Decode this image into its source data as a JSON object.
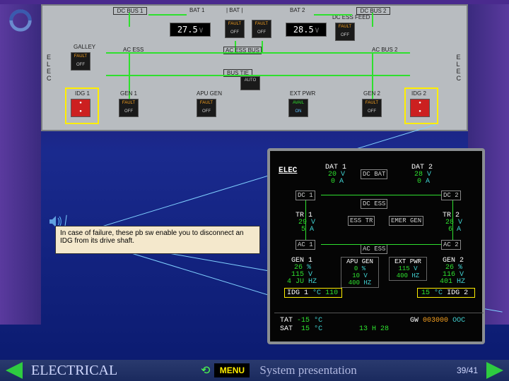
{
  "logo_name": "swirl-logo",
  "overhead": {
    "elec_label": "E L E C",
    "labels": {
      "dc_bus1": "DC BUS 1",
      "dc_bus2": "DC BUS 2",
      "bat1": "BAT 1",
      "bat2": "BAT 2",
      "bat_tog": "| BAT |",
      "dc_ess_feed": "DC ESS FEED",
      "galley": "GALLEY",
      "ac_ess": "AC ESS",
      "ac_ess_bus": "AC ESS BUS",
      "ac_bus2": "AC BUS 2",
      "bus_tie": "BUS TIE",
      "idg1": "IDG 1",
      "idg2": "IDG 2",
      "gen1": "GEN 1",
      "gen2": "GEN 2",
      "apu_gen": "APU GEN",
      "ext_pwr": "EXT PWR"
    },
    "batt1": {
      "value": "27.5",
      "unit": "V"
    },
    "batt2": {
      "value": "28.5",
      "unit": "V"
    },
    "pbsw": {
      "fault": "FAULT",
      "off": "OFF",
      "auto": "AUTO",
      "avail": "AVAIL",
      "on": "ON"
    }
  },
  "tooltip": "In case of failure, these pb sw enable you to disconnect an IDG from its drive shaft.",
  "ecam": {
    "title": "ELEC",
    "dc_bat": "DC BAT",
    "dat1": {
      "label": "DAT 1",
      "v": "20",
      "a": "0"
    },
    "dat2": {
      "label": "DAT 2",
      "v": "28",
      "a": "0"
    },
    "dc1": "DC 1",
    "dc2": "DC 2",
    "dc_ess": "DC ESS",
    "tr1": {
      "label": "TR 1",
      "v": "29",
      "a": "5"
    },
    "tr2": {
      "label": "TR 2",
      "v": "28",
      "a": "6"
    },
    "ess_tr": "ESS TR",
    "emer_gen": "EMER GEN",
    "ac1": "AC 1",
    "ac2": "AC 2",
    "ac_ess": "AC ESS",
    "gen1": {
      "label": "GEN 1",
      "pct": "26",
      "v": "115",
      "hz": "4 JU"
    },
    "gen2": {
      "label": "GEN 2",
      "pct": "26",
      "v": "116",
      "hz": "401"
    },
    "apu": {
      "label": "APU GEN",
      "pct": "0",
      "v": "10",
      "hz": "400"
    },
    "ext": {
      "label": "EXT PWR",
      "v": "115",
      "hz": "400"
    },
    "idg1": {
      "label": "IDG 1",
      "t": "110"
    },
    "idg2": {
      "label": "IDG 2",
      "t": "15"
    },
    "tat": {
      "label": "TAT",
      "v": "-15",
      "u": "°C"
    },
    "sat": {
      "label": "SAT",
      "v": "15",
      "u": "°C"
    },
    "clock": "13 H 28",
    "gw": {
      "label": "GW",
      "v": "003000",
      "u": "OOC"
    },
    "unit_v": "V",
    "unit_a": "A",
    "unit_pct": "%",
    "unit_hz": "HZ",
    "unit_c": "°C"
  },
  "bottombar": {
    "title": "ELECTRICAL",
    "menu": "MENU",
    "subtitle": "System presentation",
    "page": "39/41"
  }
}
